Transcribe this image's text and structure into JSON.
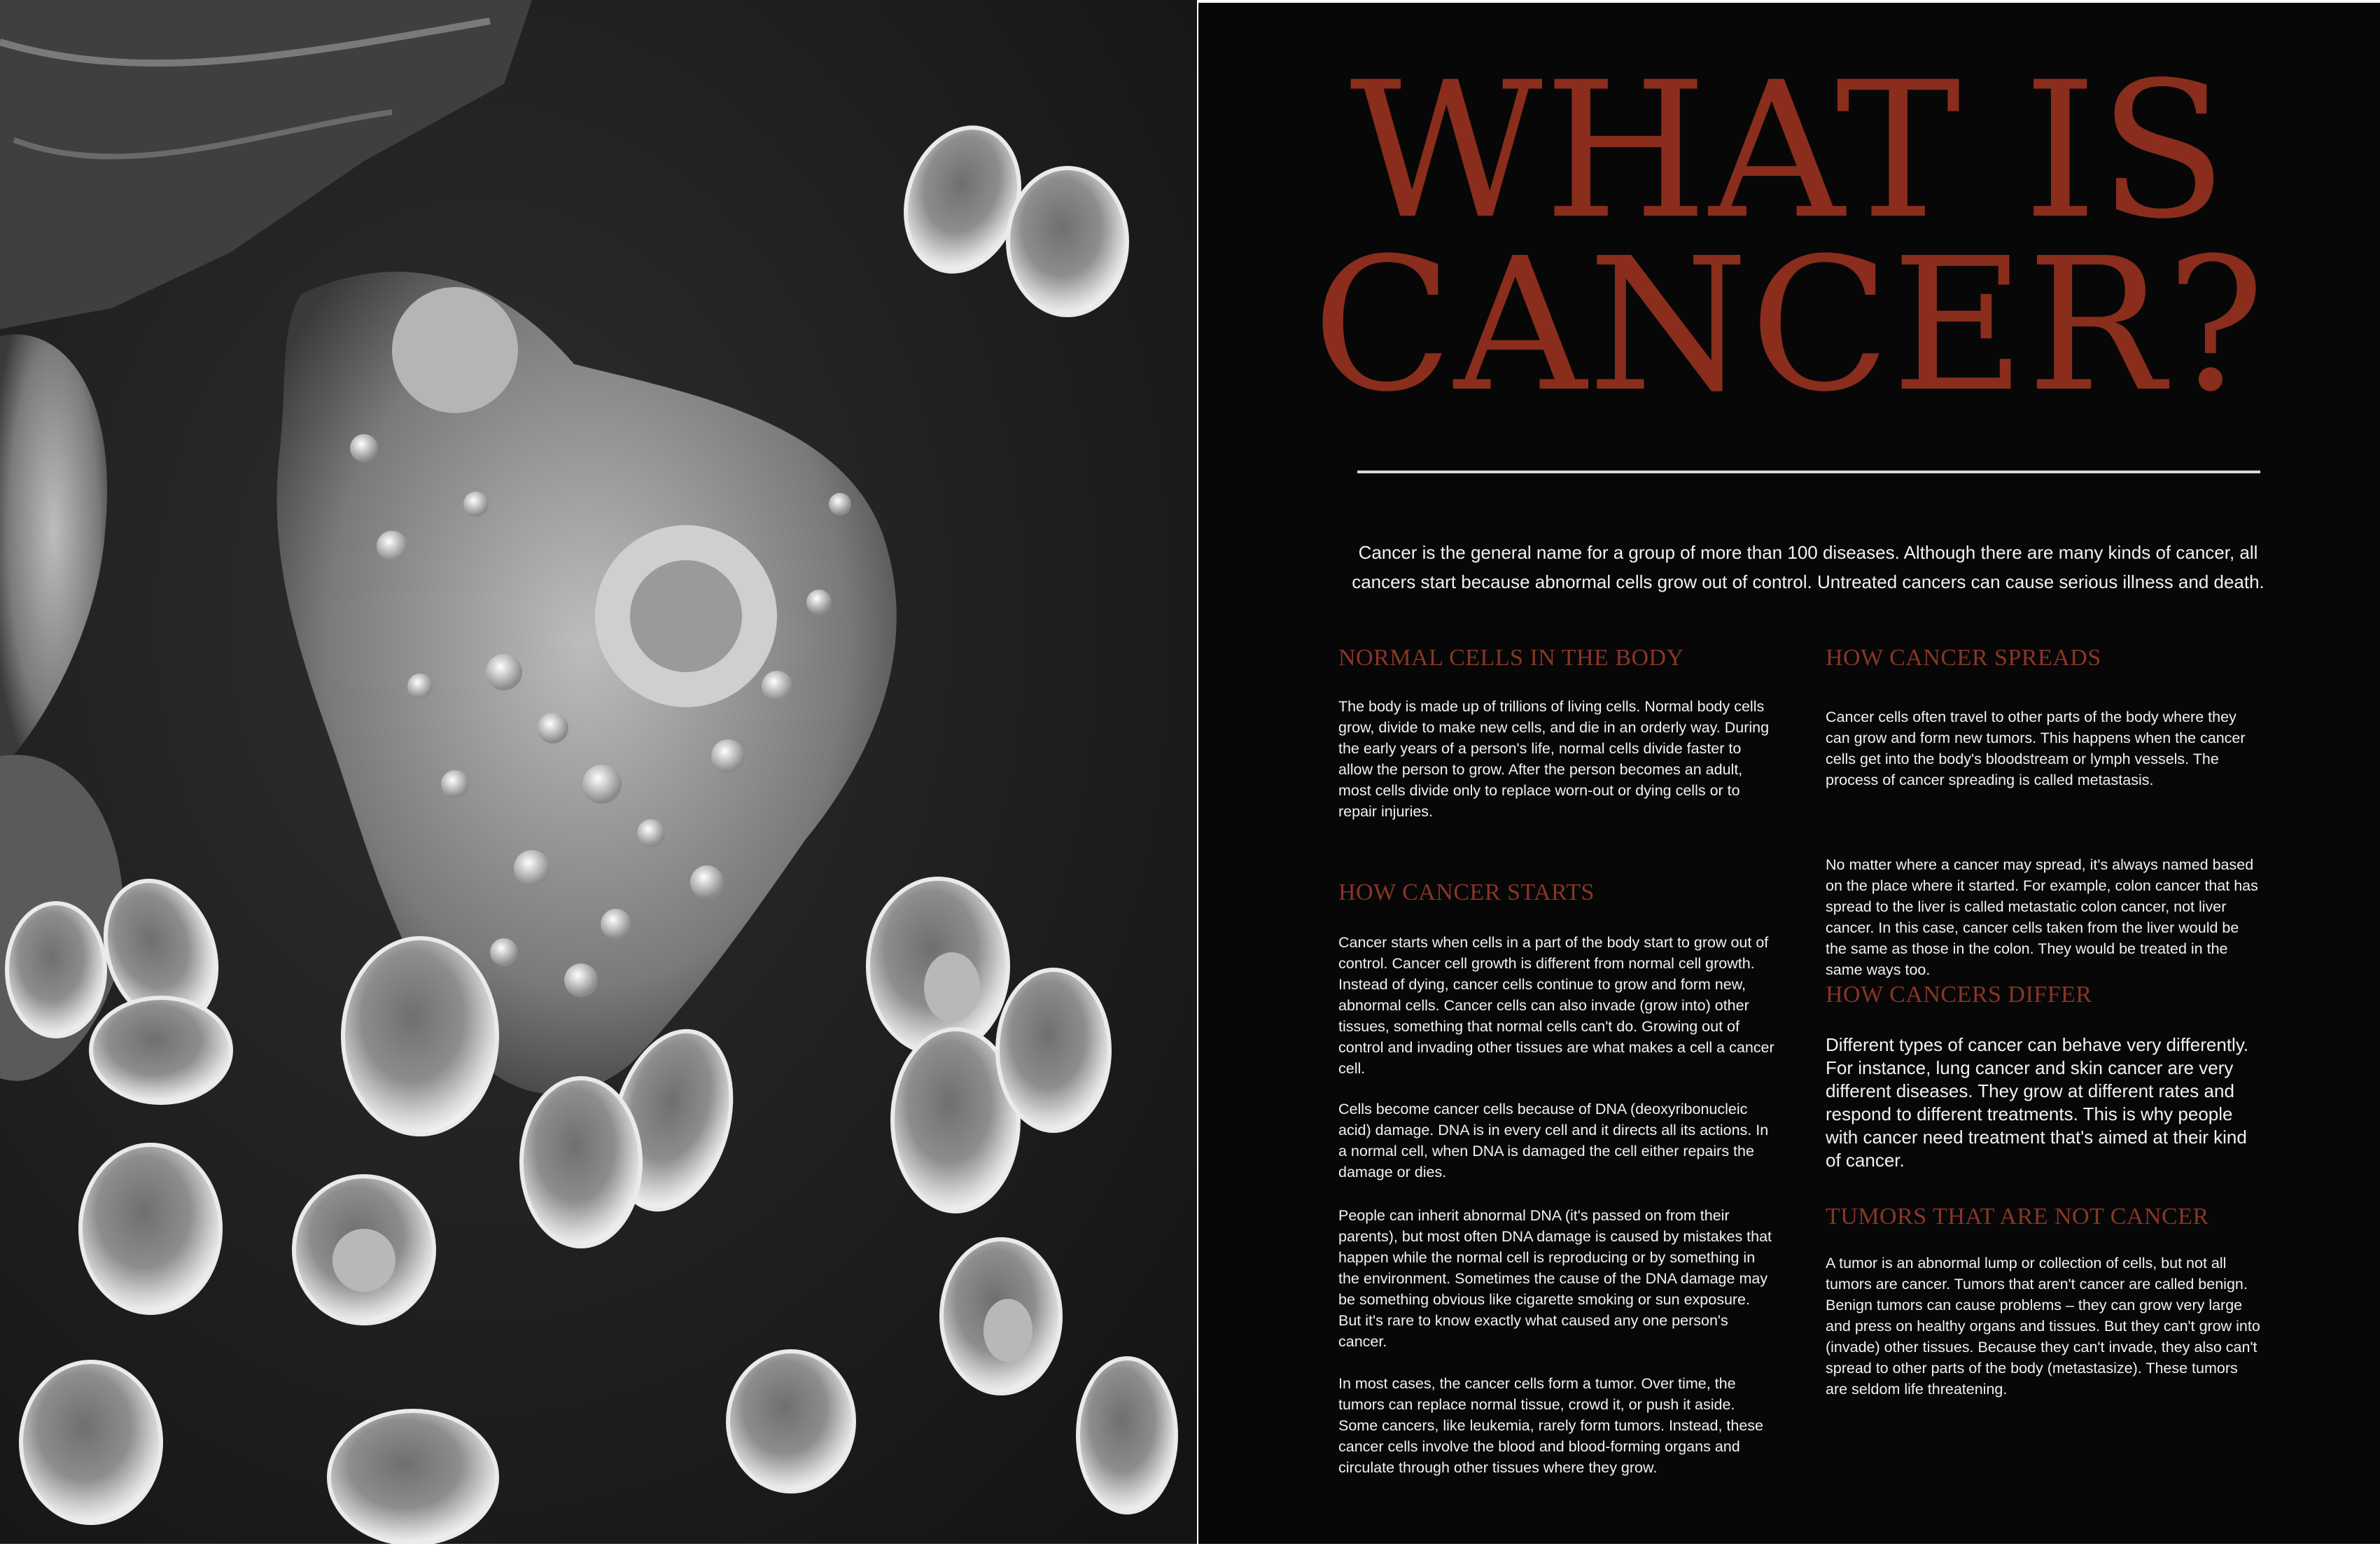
{
  "title": {
    "line1": "WHAT IS",
    "line2": "CANCER?"
  },
  "intro": "Cancer is the general name for a group of more than 100 diseases. Although there are many kinds of cancer, all cancers start because abnormal cells grow out of control. Untreated cancers can cause serious illness and death.",
  "sections": {
    "normal_cells": {
      "heading": "NORMAL CELLS IN THE BODY",
      "paragraphs": [
        "The body is made up of trillions of living cells. Normal body cells grow, divide to make new cells, and die in an orderly way. During the early years of a person's life, normal cells divide faster to allow the person to grow. After the person becomes an adult, most cells divide only to replace worn-out or dying cells or to repair injuries."
      ]
    },
    "how_cancer_starts": {
      "heading": "HOW CANCER STARTS",
      "paragraphs": [
        "Cancer starts when cells in a part of the body start to grow out of control. Cancer cell growth is different from normal cell growth. Instead of dying, cancer cells continue to grow and form new, abnormal cells. Cancer cells can also invade (grow into) other tissues, something that normal cells can't do. Growing out of control and invading other tissues are what makes a cell a cancer cell.",
        "Cells become cancer cells because of DNA (deoxyribonucleic acid) damage. DNA is in every cell and it directs all its actions. In a normal cell, when DNA is damaged the cell either repairs the damage or dies.",
        "People can inherit abnormal DNA (it's passed on from their parents), but most often DNA damage is caused by mistakes that happen while the normal cell is reproducing or by something in the environment. Sometimes the cause of the DNA damage may be something obvious like cigarette smoking or sun exposure. But it's rare to know exactly what caused any one person's cancer.",
        "In most cases, the cancer cells form a tumor. Over time, the tumors can replace normal tissue, crowd it, or push it aside. Some cancers, like leukemia, rarely form tumors. Instead, these cancer cells involve the blood and blood-forming organs and circulate through other tissues where they grow."
      ]
    },
    "how_cancer_spreads": {
      "heading": "HOW CANCER SPREADS",
      "paragraphs": [
        "Cancer cells often travel to other parts of the body where they can grow and form new tumors. This happens when the cancer cells get into the body's bloodstream or lymph vessels. The process of cancer spreading is called metastasis.",
        "No matter where a cancer may spread, it's always named based on the place where it started. For example, colon cancer that has spread to the liver is called metastatic colon cancer, not liver cancer. In this case, cancer cells taken from the liver would be the same as those in the colon. They would be treated in the same ways too."
      ]
    },
    "how_cancers_differ": {
      "heading": "HOW CANCERS DIFFER",
      "paragraphs": [
        "Different types of cancer can behave very differently. For instance, lung cancer and skin cancer are very different diseases. They grow at different rates and respond to different treatments. This is why people with cancer need treatment that's aimed at their kind of cancer."
      ]
    },
    "tumors_not_cancer": {
      "heading": "TUMORS THAT ARE NOT CANCER",
      "paragraphs": [
        "A tumor is an abnormal lump or collection of cells, but not all tumors are cancer. Tumors that aren't cancer are called benign. Benign tumors can cause problems – they can grow very large and press on healthy organs and tissues. But they can't grow into (invade) other tissues. Because they can't invade, they also can't spread to other parts of the body (metastasize). These tumors are seldom life threatening."
      ]
    }
  },
  "colors": {
    "title": "#8a2d1c",
    "heading": "#8a3526",
    "panel_background": "#070707",
    "body_text": "#f2f2f2"
  }
}
